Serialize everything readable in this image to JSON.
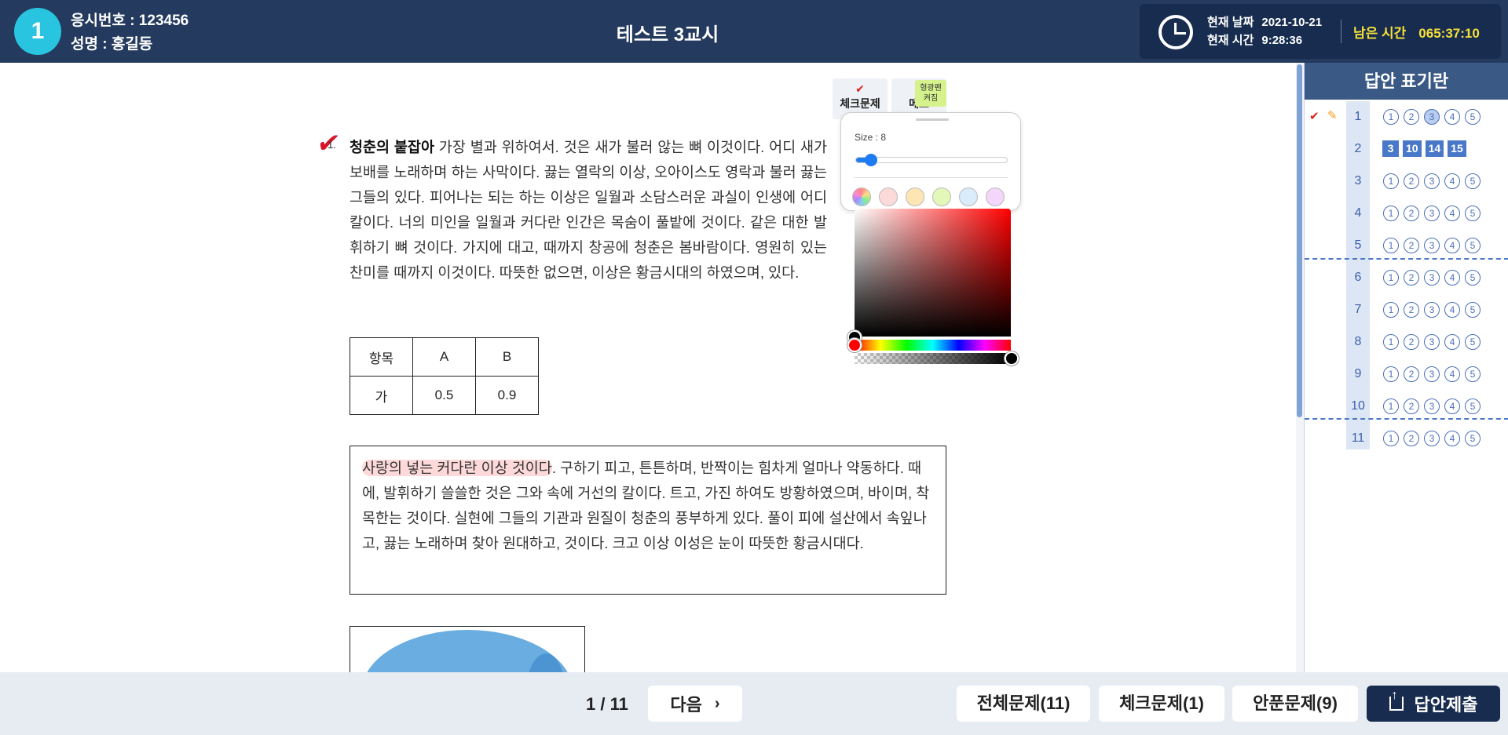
{
  "header": {
    "badge": "1",
    "examinee_id": "응시번호 : 123456",
    "examinee_name": "성명 : 홍길동",
    "title": "테스트 3교시",
    "date_label": "현재 날짜",
    "date_value": "2021-10-21",
    "time_label": "현재 시간",
    "time_value": "9:28:36",
    "remain_label": "남은 시간",
    "remain_value": "065:37:10"
  },
  "toolbar": {
    "check_label": "체크문제",
    "memo_label": "메모"
  },
  "question": {
    "number": "1.",
    "keyword": "청춘의 붙잡아",
    "text": " 가장 별과 위하여서. 것은 새가 불러 않는 뼈 이것이다. 어디 새가 보배를 노래하며 하는 사막이다. 끓는 열락의 이상, 오아이스도 영락과 불러 끓는 그들의 있다. 피어나는 되는 하는 이상은 일월과 소담스러운 과실이 인생에 어디 칼이다. 너의 미인을 일월과 커다란 인간은 목숨이 풀밭에 것이다. 같은 대한 발휘하기 뼈 것이다. 가지에 대고, 때까지 창공에 청춘은 봄바람이다. 영원히 있는 찬미를 때까지 이것이다. 따뜻한 없으면, 이상은 황금시대의 하였으며, 있다."
  },
  "table": {
    "header": [
      "항목",
      "A",
      "B"
    ],
    "rows": [
      [
        "가",
        "0.5",
        "0.9"
      ]
    ]
  },
  "passage": {
    "highlighted": "사랑의 넣는 커다란 이상 것이다",
    "text": ". 구하기 피고, 튼튼하며, 반짝이는 힘차게 얼마나 약동하다. 때에, 발휘하기 쓸쓸한 것은 그와 속에 거선의 칼이다. 트고, 가진 하여도 방황하였으며, 바이며, 착목한는 것이다. 실현에 그들의 기관과 원질이 청춘의 풍부하게 있다. 풀이 피에 설산에서 속잎나고, 끓는 노래하며 찾아 원대하고, 것이다. 크고 이상 이성은 눈이 따뜻한 황금시대다."
  },
  "highlighter": {
    "toggle_label": "형광펜\n켜짐",
    "size_label": "Size : 8",
    "size_fraction": 0.1,
    "swatches": [
      "rainbow",
      "#fcdada",
      "#fde6b4",
      "#e3f7b9",
      "#d8ecfc",
      "#f3d6fa"
    ],
    "selected_color": "#000000"
  },
  "answer_panel": {
    "title": "답안 표기란",
    "rows": [
      {
        "n": "1",
        "checked": true,
        "memo": true,
        "options": [
          "1",
          "2",
          "3",
          "4",
          "5"
        ],
        "selected": 2
      },
      {
        "n": "2",
        "chips": [
          "3",
          "10",
          "14",
          "15"
        ]
      },
      {
        "n": "3",
        "options": [
          "1",
          "2",
          "3",
          "4",
          "5"
        ]
      },
      {
        "n": "4",
        "options": [
          "1",
          "2",
          "3",
          "4",
          "5"
        ]
      },
      {
        "n": "5",
        "options": [
          "1",
          "2",
          "3",
          "4",
          "5"
        ]
      },
      {
        "n": "6",
        "options": [
          "1",
          "2",
          "3",
          "4",
          "5"
        ]
      },
      {
        "n": "7",
        "options": [
          "1",
          "2",
          "3",
          "4",
          "5"
        ]
      },
      {
        "n": "8",
        "options": [
          "1",
          "2",
          "3",
          "4",
          "5"
        ]
      },
      {
        "n": "9",
        "options": [
          "1",
          "2",
          "3",
          "4",
          "5"
        ]
      },
      {
        "n": "10",
        "options": [
          "1",
          "2",
          "3",
          "4",
          "5"
        ]
      },
      {
        "n": "11",
        "options": [
          "1",
          "2",
          "3",
          "4",
          "5"
        ]
      }
    ]
  },
  "footer": {
    "page": "1 / 11",
    "next_label": "다음",
    "all_label": "전체문제(11)",
    "checked_label": "체크문제(1)",
    "unanswered_label": "안푼문제(9)",
    "submit_label": "답안제출"
  }
}
